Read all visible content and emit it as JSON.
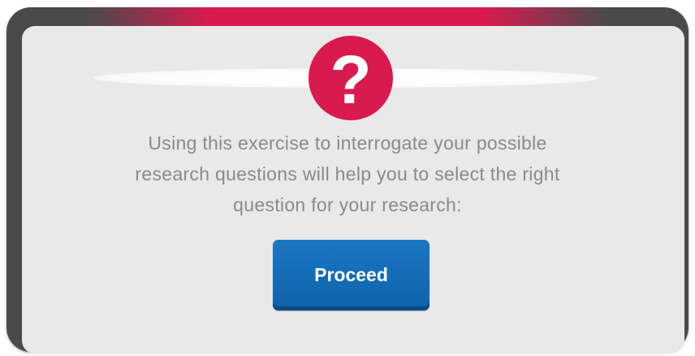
{
  "dialog": {
    "icon": "question-mark-icon",
    "icon_glyph": "?",
    "message_lines": [
      "Using this exercise to interrogate your possible",
      "research questions will help you to select the right",
      "question for your research:"
    ],
    "proceed_label": "Proceed"
  },
  "colors": {
    "accent_red": "#d91a4e",
    "button_blue": "#1467b2",
    "frame_gray": "#4a4a4c",
    "panel_bg": "#e9e9e9",
    "text_gray": "#8a8a8a"
  }
}
